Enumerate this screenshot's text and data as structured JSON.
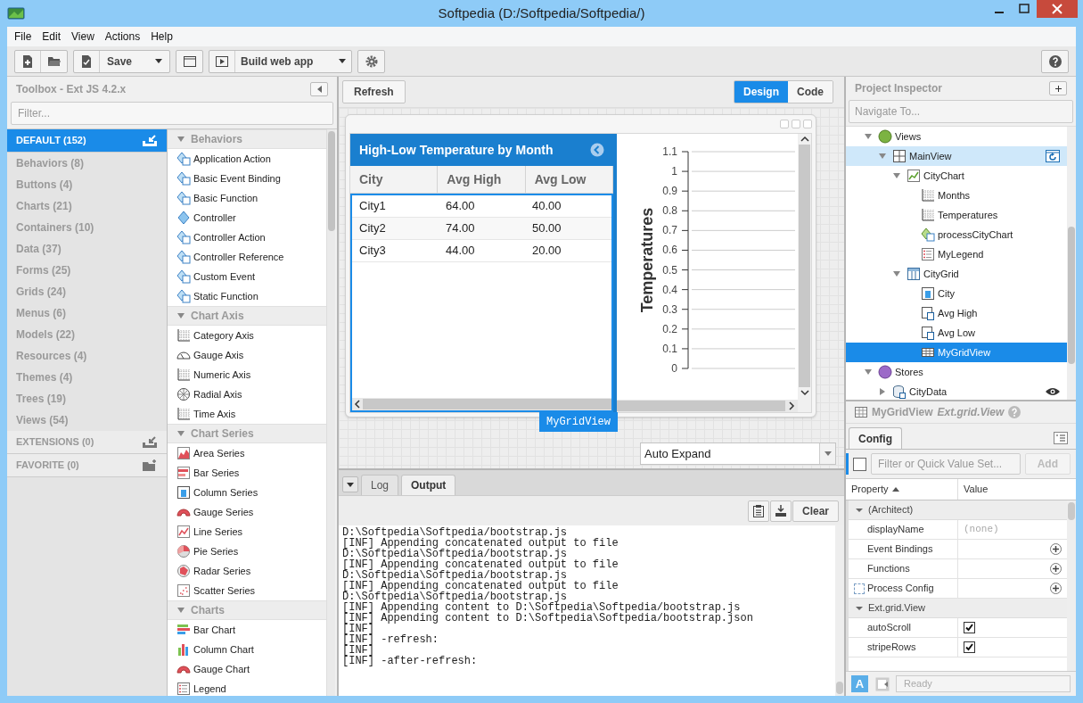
{
  "window": {
    "title": "Softpedia (D:/Softpedia/Softpedia/)"
  },
  "menu": [
    "File",
    "Edit",
    "View",
    "Actions",
    "Help"
  ],
  "toolbar": {
    "save_label": "Save",
    "build_label": "Build web app"
  },
  "toolbox": {
    "title": "Toolbox - Ext JS 4.2.x",
    "filter_placeholder": "Filter...",
    "categories": [
      {
        "label": "DEFAULT (152)",
        "kind": "section",
        "selected": true
      },
      {
        "label": "Behaviors (8)",
        "kind": "item",
        "selected": false
      },
      {
        "label": "Buttons (4)",
        "kind": "item",
        "selected": false
      },
      {
        "label": "Charts (21)",
        "kind": "item",
        "selected": false
      },
      {
        "label": "Containers (10)",
        "kind": "item",
        "selected": false
      },
      {
        "label": "Data (37)",
        "kind": "item",
        "selected": false
      },
      {
        "label": "Forms (25)",
        "kind": "item",
        "selected": false
      },
      {
        "label": "Grids (24)",
        "kind": "item",
        "selected": false
      },
      {
        "label": "Menus (6)",
        "kind": "item",
        "selected": false
      },
      {
        "label": "Models (22)",
        "kind": "item",
        "selected": false
      },
      {
        "label": "Resources (4)",
        "kind": "item",
        "selected": false
      },
      {
        "label": "Themes (4)",
        "kind": "item",
        "selected": false
      },
      {
        "label": "Trees (19)",
        "kind": "item",
        "selected": false
      },
      {
        "label": "Views (54)",
        "kind": "item",
        "selected": false
      },
      {
        "label": "EXTENSIONS (0)",
        "kind": "section",
        "selected": false
      },
      {
        "label": "FAVORITE (0)",
        "kind": "section",
        "selected": false
      }
    ],
    "groups": [
      {
        "title": "Behaviors",
        "items": [
          {
            "label": "Application Action",
            "kind": "behavior"
          },
          {
            "label": "Basic Event Binding",
            "kind": "behavior"
          },
          {
            "label": "Basic Function",
            "kind": "behavior"
          },
          {
            "label": "Controller",
            "kind": "controller"
          },
          {
            "label": "Controller Action",
            "kind": "behavior"
          },
          {
            "label": "Controller Reference",
            "kind": "behavior"
          },
          {
            "label": "Custom Event",
            "kind": "behavior"
          },
          {
            "label": "Static Function",
            "kind": "behavior"
          }
        ]
      },
      {
        "title": "Chart Axis",
        "items": [
          {
            "label": "Category Axis",
            "kind": "axis"
          },
          {
            "label": "Gauge Axis",
            "kind": "gauge-axis"
          },
          {
            "label": "Numeric Axis",
            "kind": "axis"
          },
          {
            "label": "Radial Axis",
            "kind": "radial-axis"
          },
          {
            "label": "Time Axis",
            "kind": "axis"
          }
        ]
      },
      {
        "title": "Chart Series",
        "items": [
          {
            "label": "Area Series",
            "kind": "area"
          },
          {
            "label": "Bar Series",
            "kind": "bar"
          },
          {
            "label": "Column Series",
            "kind": "column"
          },
          {
            "label": "Gauge Series",
            "kind": "gauge"
          },
          {
            "label": "Line Series",
            "kind": "line"
          },
          {
            "label": "Pie Series",
            "kind": "pie"
          },
          {
            "label": "Radar Series",
            "kind": "radar"
          },
          {
            "label": "Scatter Series",
            "kind": "scatter"
          }
        ]
      },
      {
        "title": "Charts",
        "items": [
          {
            "label": "Bar Chart",
            "kind": "bar-chart"
          },
          {
            "label": "Column Chart",
            "kind": "column-chart"
          },
          {
            "label": "Gauge Chart",
            "kind": "gauge"
          },
          {
            "label": "Legend",
            "kind": "legend"
          }
        ]
      }
    ]
  },
  "designer": {
    "refresh": "Refresh",
    "tabs": [
      {
        "label": "Design",
        "selected": true
      },
      {
        "label": "Code",
        "selected": false
      }
    ],
    "grid": {
      "title": "High-Low Temperature by Month",
      "columns": [
        "City",
        "Avg High",
        "Avg Low"
      ],
      "rows": [
        [
          "City1",
          "64.00",
          "40.00"
        ],
        [
          "City2",
          "74.00",
          "50.00"
        ],
        [
          "City3",
          "44.00",
          "20.00"
        ]
      ]
    },
    "selection_tag": "MyGridView",
    "chart": {
      "axis_title": "Temperatures",
      "tick_labels": [
        "1.1",
        "1",
        "0.9",
        "0.8",
        "0.7",
        "0.6",
        "0.5",
        "0.4",
        "0.3",
        "0.2",
        "0.1",
        "0"
      ]
    },
    "layout_combo": "Auto Expand"
  },
  "output": {
    "tabs": [
      {
        "label": "Log",
        "selected": false
      },
      {
        "label": "Output",
        "selected": true
      }
    ],
    "clear": "Clear",
    "lines": [
      "D:\\Softpedia\\Softpedia/bootstrap.js",
      "[INF] Appending concatenated output to file",
      "D:\\Softpedia\\Softpedia/bootstrap.js",
      "[INF] Appending concatenated output to file",
      "D:\\Softpedia\\Softpedia/bootstrap.js",
      "[INF] Appending concatenated output to file",
      "D:\\Softpedia\\Softpedia/bootstrap.js",
      "[INF] Appending content to D:\\Softpedia\\Softpedia/bootstrap.js",
      "[INF] Appending content to D:\\Softpedia\\Softpedia/bootstrap.json",
      "[INF]",
      "[INF] -refresh:",
      "[INF]",
      "[INF] -after-refresh:"
    ]
  },
  "inspector": {
    "title": "Project Inspector",
    "navigate_placeholder": "Navigate To...",
    "tree": [
      {
        "label": "Views",
        "kind": "views",
        "expanded": true,
        "selected": false,
        "highlighted": false,
        "children": [
          {
            "label": "MainView",
            "kind": "container",
            "expanded": true,
            "selected": false,
            "highlighted": true,
            "action": {
              "kind": "refresh"
            },
            "children": [
              {
                "label": "CityChart",
                "kind": "chart",
                "expanded": true,
                "selected": false,
                "highlighted": false,
                "children": [
                  {
                    "label": "Months",
                    "kind": "axis",
                    "selected": false,
                    "highlighted": false
                  },
                  {
                    "label": "Temperatures",
                    "kind": "axis",
                    "selected": false,
                    "highlighted": false
                  },
                  {
                    "label": "processCityChart",
                    "kind": "function",
                    "selected": false,
                    "highlighted": false
                  },
                  {
                    "label": "MyLegend",
                    "kind": "legend",
                    "selected": false,
                    "highlighted": false
                  }
                ]
              },
              {
                "label": "CityGrid",
                "kind": "grid",
                "expanded": true,
                "selected": false,
                "highlighted": false,
                "children": [
                  {
                    "label": "City",
                    "kind": "column",
                    "selected": false,
                    "highlighted": false
                  },
                  {
                    "label": "Avg High",
                    "kind": "numbercolumn",
                    "selected": false,
                    "highlighted": false
                  },
                  {
                    "label": "Avg Low",
                    "kind": "numbercolumn",
                    "selected": false,
                    "highlighted": false
                  },
                  {
                    "label": "MyGridView",
                    "kind": "gridview",
                    "selected": true,
                    "highlighted": false
                  }
                ]
              }
            ]
          }
        ]
      },
      {
        "label": "Stores",
        "kind": "stores",
        "expanded": true,
        "selected": false,
        "highlighted": false,
        "children": [
          {
            "label": "CityData",
            "kind": "store",
            "expanded": false,
            "selected": false,
            "highlighted": false,
            "action": {
              "kind": "preview"
            }
          }
        ]
      }
    ]
  },
  "config": {
    "component": "MyGridView",
    "class": "Ext.grid.View",
    "tab": "Config",
    "select_all_checked": false,
    "filter_placeholder": "Filter or Quick Value Set...",
    "add": "Add",
    "columns": [
      "Property",
      "Value"
    ],
    "groups": [
      {
        "title": "(Architect)",
        "expanded": true,
        "rows": [
          {
            "property": "displayName",
            "kind": "text",
            "value": "(none)"
          },
          {
            "property": "Event Bindings",
            "kind": "add"
          },
          {
            "property": "Functions",
            "kind": "add"
          },
          {
            "property": "Process Config",
            "kind": "plugin"
          }
        ]
      },
      {
        "title": "Ext.grid.View",
        "expanded": true,
        "rows": [
          {
            "property": "autoScroll",
            "kind": "check",
            "checked": true
          },
          {
            "property": "stripeRows",
            "kind": "check",
            "checked": true
          }
        ]
      }
    ],
    "mode_button": "A",
    "status": "Ready"
  }
}
